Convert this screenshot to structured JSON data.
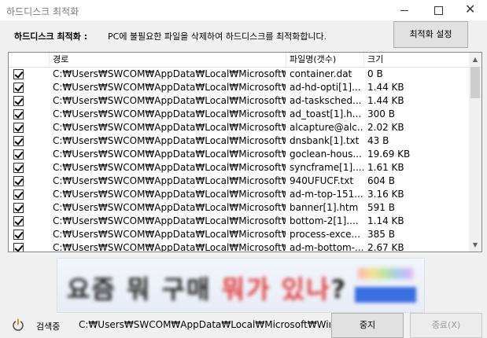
{
  "window": {
    "title": "하드디스크 최적화",
    "close_glyph": "✕"
  },
  "header": {
    "label": "하드디스크 최적화 :",
    "description": "PC에 불필요한 파일을 삭제하여 하드디스크를 최적화합니다.",
    "settings_button": "최적화 설정"
  },
  "list": {
    "columns": [
      "",
      "경로",
      "파일명(갯수)",
      "크기"
    ],
    "rows": [
      {
        "checked": true,
        "path": "C:₩Users₩SWCOM₩AppData₩Local₩Microsoft₩...",
        "name": "container.dat",
        "size": "0 B"
      },
      {
        "checked": true,
        "path": "C:₩Users₩SWCOM₩AppData₩Local₩Microsoft₩...",
        "name": "ad-hd-opti[1]...",
        "size": "1.44 KB"
      },
      {
        "checked": true,
        "path": "C:₩Users₩SWCOM₩AppData₩Local₩Microsoft₩...",
        "name": "ad-tasksched...",
        "size": "1.44 KB"
      },
      {
        "checked": true,
        "path": "C:₩Users₩SWCOM₩AppData₩Local₩Microsoft₩...",
        "name": "ad_toast[1].h...",
        "size": "300 B"
      },
      {
        "checked": true,
        "path": "C:₩Users₩SWCOM₩AppData₩Local₩Microsoft₩...",
        "name": "alcapture@alc...",
        "size": "2.02 KB"
      },
      {
        "checked": true,
        "path": "C:₩Users₩SWCOM₩AppData₩Local₩Microsoft₩...",
        "name": "dnsbank[1].txt",
        "size": "43 B"
      },
      {
        "checked": true,
        "path": "C:₩Users₩SWCOM₩AppData₩Local₩Microsoft₩...",
        "name": "goclean-hous...",
        "size": "19.69 KB"
      },
      {
        "checked": true,
        "path": "C:₩Users₩SWCOM₩AppData₩Local₩Microsoft₩...",
        "name": "syncframe[1]....",
        "size": "1.61 KB"
      },
      {
        "checked": true,
        "path": "C:₩Users₩SWCOM₩AppData₩Local₩Microsoft₩...",
        "name": "940UFUCF.txt",
        "size": "604 B"
      },
      {
        "checked": true,
        "path": "C:₩Users₩SWCOM₩AppData₩Local₩Microsoft₩...",
        "name": "ad-m-top-151...",
        "size": "3.16 KB"
      },
      {
        "checked": true,
        "path": "C:₩Users₩SWCOM₩AppData₩Local₩Microsoft₩...",
        "name": "banner[1].htm",
        "size": "591 B"
      },
      {
        "checked": true,
        "path": "C:₩Users₩SWCOM₩AppData₩Local₩Microsoft₩...",
        "name": "bottom-2[1]....",
        "size": "1.14 KB"
      },
      {
        "checked": true,
        "path": "C:₩Users₩SWCOM₩AppData₩Local₩Microsoft₩...",
        "name": "process-exce...",
        "size": "385 B"
      },
      {
        "checked": true,
        "path": "C:₩Users₩SWCOM₩AppData₩Local₩Microsoft₩...",
        "name": "ad-m-bottom-...",
        "size": "2.67 KB"
      }
    ]
  },
  "ad": {
    "text_main": "요즘 뭐 구매 ",
    "text_highlight": "뭐가 있나",
    "text_end": "?"
  },
  "status": {
    "label": "검색중",
    "current_path": "C:₩Users₩SWCOM₩AppData₩Local₩Microsoft₩Window",
    "stop_button": "중지",
    "exit_button": "종료(X)"
  }
}
